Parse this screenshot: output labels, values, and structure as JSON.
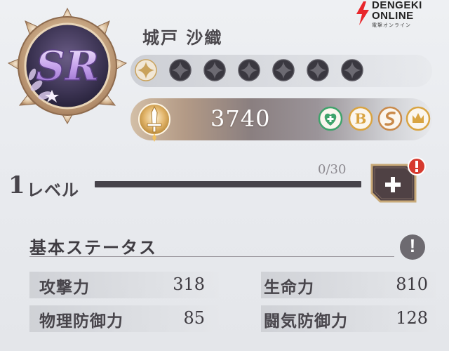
{
  "watermark": {
    "line1": "DENGEKI",
    "line2": "ONLINE",
    "line3": "電撃オンライン"
  },
  "character": {
    "rarity": "SR",
    "name": "城戸 沙織",
    "stars_total": 7,
    "stars_filled": 1,
    "power": "3740"
  },
  "badges": [
    {
      "icon": "heal-cross-icon",
      "color": "#3fa36b"
    },
    {
      "icon": "B-class-icon",
      "label": "B",
      "color": "#d9a441"
    },
    {
      "icon": "swirl-element-icon",
      "color": "#c98a4a"
    },
    {
      "icon": "crown-faction-icon",
      "color": "#d9a441"
    }
  ],
  "level": {
    "number": "1",
    "label": "レベル",
    "progress_text": "0/30",
    "progress": 0.0
  },
  "stats_section": {
    "title": "基本ステータス",
    "rows": [
      {
        "left_label": "攻撃力",
        "left_value": "318",
        "right_label": "生命力",
        "right_value": "810"
      },
      {
        "left_label": "物理防御力",
        "left_value": "85",
        "right_label": "闘気防御力",
        "right_value": "128"
      }
    ]
  },
  "colors": {
    "accent_gold": "#c9a25c",
    "star_dark": "#3a3840",
    "alert_red": "#d63a2f"
  }
}
